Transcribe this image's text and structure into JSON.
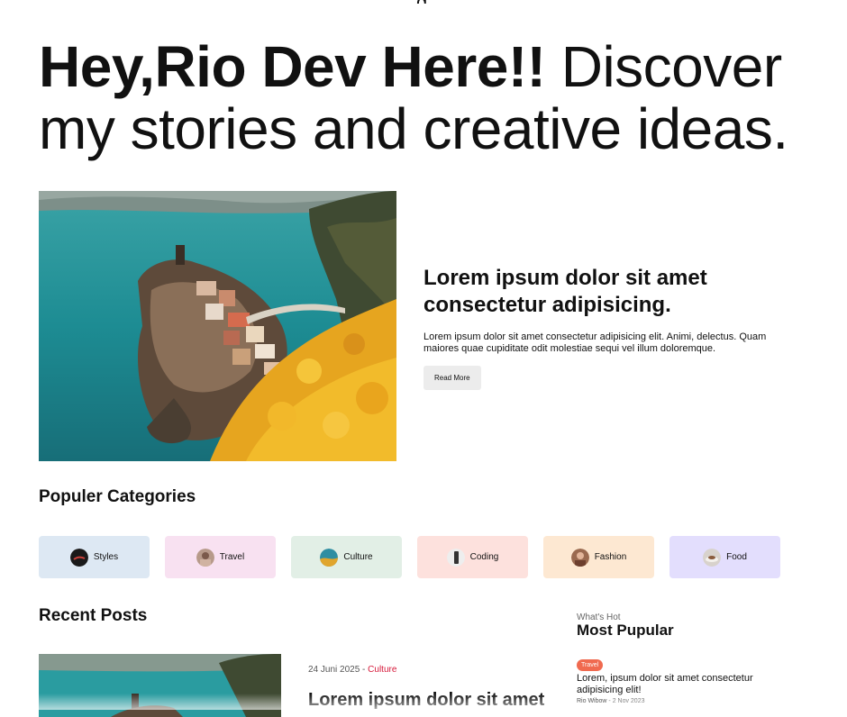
{
  "header": {
    "stub": "g"
  },
  "hero": {
    "title_bold": "Hey,Rio Dev Here!!",
    "title_rest": " Discover my stories and creative ideas."
  },
  "featured": {
    "image_alt": "coastal village on cliffs above turquoise sea with yellow flowers",
    "title": "Lorem ipsum dolor sit amet consectetur adipisicing.",
    "description": "Lorem ipsum dolor sit amet consectetur adipisicing elit. Animi, delectus. Quam maiores quae cupiditate odit molestiae sequi vel illum doloremque.",
    "button_label": "Read More"
  },
  "categories": {
    "title": "Populer Categories",
    "items": [
      {
        "label": "Styles",
        "bg": "#dde8f3",
        "icon": "styles-avatar-icon"
      },
      {
        "label": "Travel",
        "bg": "#f8e1f1",
        "icon": "travel-avatar-icon"
      },
      {
        "label": "Culture",
        "bg": "#e2efe6",
        "icon": "culture-avatar-icon"
      },
      {
        "label": "Coding",
        "bg": "#fde1dd",
        "icon": "coding-avatar-icon"
      },
      {
        "label": "Fashion",
        "bg": "#fde8d2",
        "icon": "fashion-avatar-icon"
      },
      {
        "label": "Food",
        "bg": "#e3defd",
        "icon": "food-avatar-icon"
      }
    ]
  },
  "recent": {
    "title": "Recent Posts",
    "post": {
      "date": "24 Juni 2025",
      "separator": " - ",
      "category": "Culture",
      "title": "Lorem ipsum dolor sit amet"
    }
  },
  "sidebar": {
    "kicker": "What's Hot",
    "title": "Most Pupular",
    "badge": "Travel",
    "post_title": "Lorem, ipsum dolor sit amet consectetur adipisicing elit!",
    "author": "Rio Wibow",
    "date_sep": " - ",
    "date": "2 Nov 2023"
  },
  "colors": {
    "accent_red": "#d6193a",
    "badge_orange": "#f06a4f",
    "button_bg": "#ececec"
  }
}
